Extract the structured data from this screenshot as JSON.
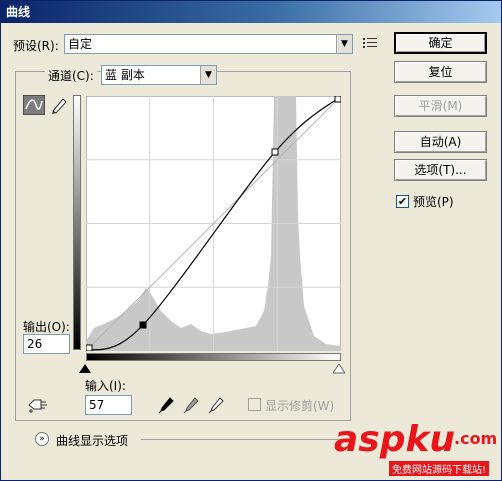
{
  "title": "曲线",
  "preset": {
    "label": "预设(R):",
    "value": "自定"
  },
  "channel": {
    "label": "通道(C):",
    "value": "蓝 副本"
  },
  "output": {
    "label": "输出(O):",
    "value": "26"
  },
  "input": {
    "label": "输入(I):",
    "value": "57"
  },
  "buttons": {
    "ok": "确定",
    "reset": "复位",
    "smooth": "平滑(M)",
    "auto": "自动(A)",
    "options": "选项(T)..."
  },
  "preview": {
    "label": "预览(P)",
    "checked": true
  },
  "show_clipping": {
    "label": "显示修剪(W)",
    "checked": false
  },
  "curve_display": "曲线显示选项",
  "watermark": {
    "text": "aspku",
    "suffix": ".com",
    "caption": "免费网站源码下载站!"
  },
  "curve": {
    "points": [
      [
        0,
        0
      ],
      [
        57,
        26
      ],
      [
        189,
        199
      ],
      [
        255,
        255
      ]
    ]
  },
  "colors": {
    "title_from": "#0a246a",
    "title_to": "#a6caf0",
    "histogram": "#c8c8c8",
    "watermark": "#e8161b"
  },
  "icons": [
    "menu-lines-icon",
    "curve-tool-icon",
    "pencil-icon",
    "hand-target-icon",
    "black-eyedropper-icon",
    "gray-eyedropper-icon",
    "white-eyedropper-icon",
    "expand-chevron-icon",
    "dropdown-arrow-icon"
  ]
}
